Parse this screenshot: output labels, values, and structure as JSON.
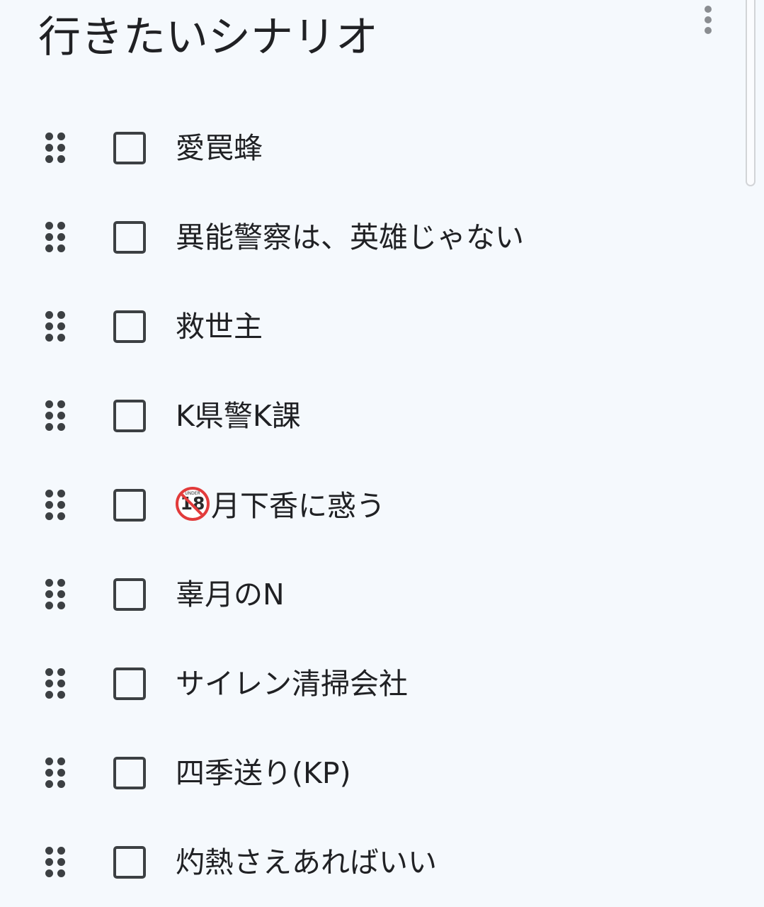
{
  "list": {
    "title": "行きたいシナリオ",
    "more_icon": "more-vert-icon",
    "items": [
      {
        "label": "愛罠蜂",
        "checked": false
      },
      {
        "label": "異能警察は、英雄じゃない",
        "checked": false
      },
      {
        "label": "救世主",
        "checked": false
      },
      {
        "label": "K県警K課",
        "checked": false
      },
      {
        "prefix_icon": "no-under-18-icon",
        "badge_text": "18",
        "badge_sub": "UNDER",
        "label": "月下香に惑う",
        "checked": false
      },
      {
        "label": "辜月のN",
        "checked": false
      },
      {
        "label": "サイレン清掃会社",
        "checked": false
      },
      {
        "label": "四季送り(KP)",
        "checked": false
      },
      {
        "label": "灼熱さえあればいい",
        "checked": false
      }
    ]
  },
  "colors": {
    "background": "#f5f9fd",
    "text": "#202124",
    "icon": "#3c4043",
    "badge_red": "#e23b3b"
  }
}
